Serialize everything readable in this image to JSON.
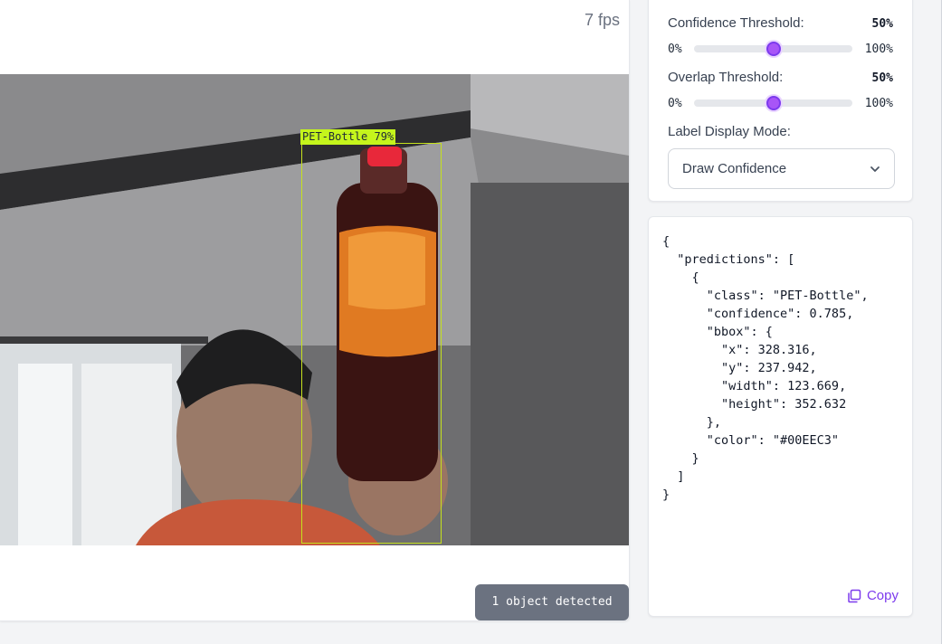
{
  "fps_text": "7 fps",
  "detection": {
    "label_text": "PET-Bottle 79%",
    "box_color": "#c5e11c"
  },
  "status_badge": "1 object detected",
  "settings": {
    "confidence_label": "Confidence Threshold:",
    "confidence_value": "50%",
    "confidence_level": 0.5,
    "overlap_label": "Overlap Threshold:",
    "overlap_value": "50%",
    "overlap_level": 0.5,
    "range_min": "0%",
    "range_max": "100%",
    "label_mode_label": "Label Display Mode:",
    "label_mode_value": "Draw Confidence"
  },
  "json_output": "{\n  \"predictions\": [\n    {\n      \"class\": \"PET-Bottle\",\n      \"confidence\": 0.785,\n      \"bbox\": {\n        \"x\": 328.316,\n        \"y\": 237.942,\n        \"width\": 123.669,\n        \"height\": 352.632\n      },\n      \"color\": \"#00EEC3\"\n    }\n  ]\n}",
  "copy_label": "Copy",
  "icons": {
    "copy": "copy-icon",
    "chevron": "chevron-down-icon"
  },
  "colors": {
    "accent": "#7c3aed",
    "badge_bg": "#6b7280"
  }
}
